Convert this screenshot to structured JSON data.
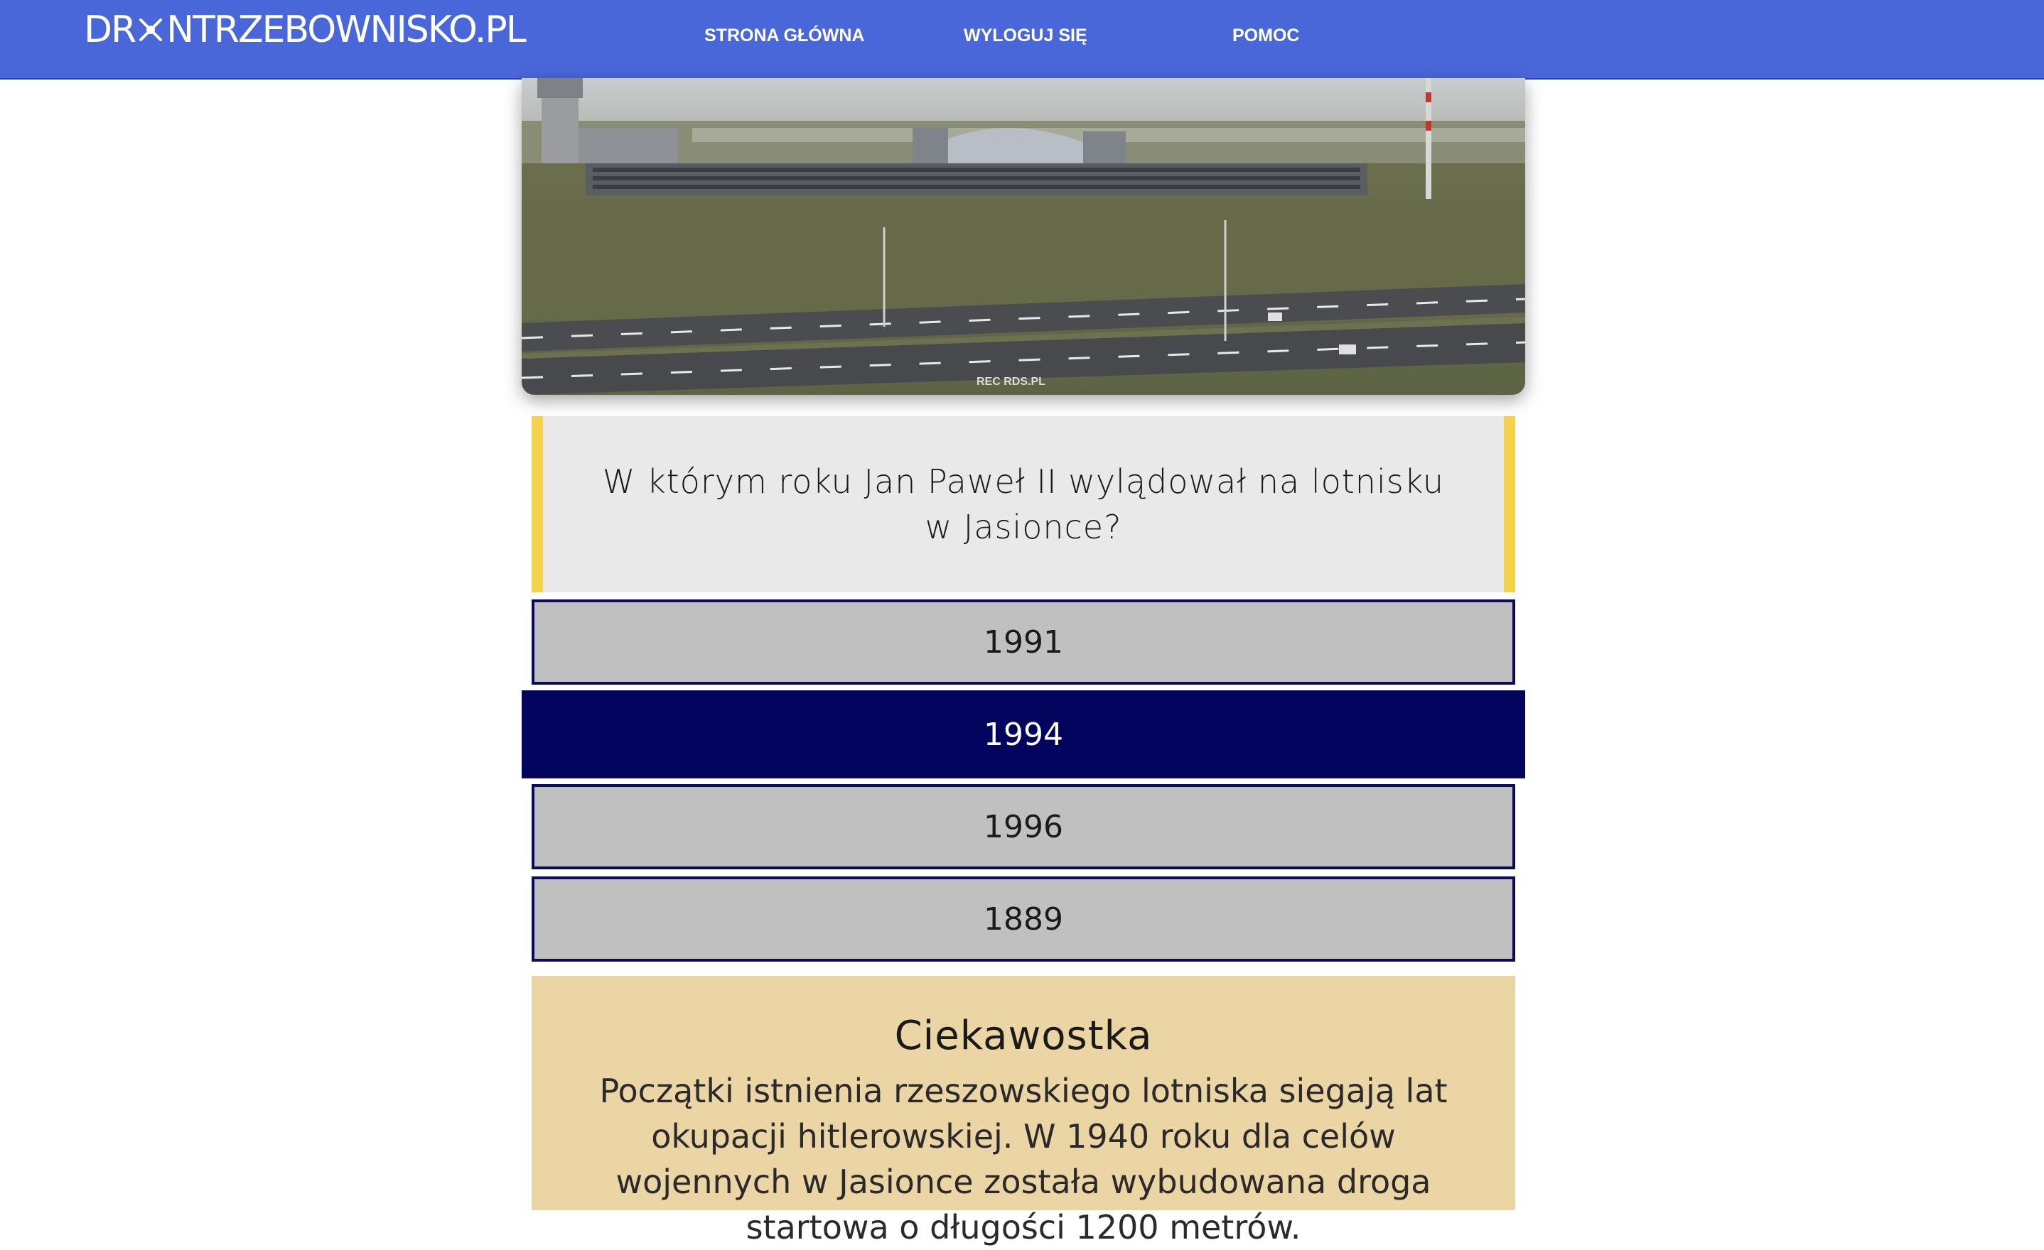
{
  "header": {
    "logo_text_1": "DR",
    "logo_text_2": "NTRZEBOWNISKO.PL",
    "nav": [
      {
        "label": "STRONA GŁÓWNA"
      },
      {
        "label": "WYLOGUJ SIĘ"
      },
      {
        "label": "POMOC"
      }
    ]
  },
  "photo": {
    "watermark": "REC RDS.PL"
  },
  "question": {
    "text": "W którym roku Jan Paweł II wylądował na lotnisku w Jasionce?"
  },
  "answers": [
    {
      "label": "1991",
      "selected": false
    },
    {
      "label": "1994",
      "selected": true
    },
    {
      "label": "1996",
      "selected": false
    },
    {
      "label": "1889",
      "selected": false
    }
  ],
  "funfact": {
    "title": "Ciekawostka",
    "text": "Początki istnienia rzeszowskiego lotniska siegają lat okupacji hitlerowskiej. W 1940 roku dla celów wojennych w Jasionce została wybudowana droga startowa o długości 1200 metrów."
  },
  "colors": {
    "header_bg": "#4A67D9",
    "question_accent": "#f4d24c",
    "answer_bg": "#c0c0c0",
    "answer_selected_bg": "#03045e",
    "funfact_bg": "#ecd5a5"
  }
}
